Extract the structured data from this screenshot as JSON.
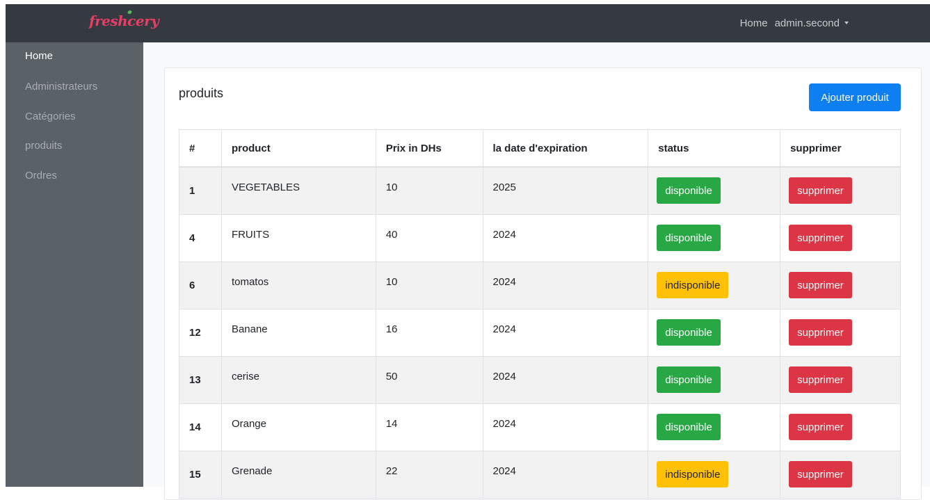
{
  "navbar": {
    "brand": "freshcery",
    "links": {
      "home": "Home",
      "user": "admin.second"
    }
  },
  "sidebar": {
    "items": [
      {
        "label": "Home",
        "active": true
      },
      {
        "label": "Administrateurs",
        "active": false
      },
      {
        "label": "Catégories",
        "active": false
      },
      {
        "label": "produits",
        "active": false
      },
      {
        "label": "Ordres",
        "active": false
      }
    ]
  },
  "main": {
    "title": "produits",
    "add_button": "Ajouter produit",
    "table": {
      "headers": [
        "#",
        "product",
        "Prix in DHs",
        "la date d'expiration",
        "status",
        "supprimer"
      ],
      "rows": [
        {
          "id": "1",
          "product": "VEGETABLES",
          "price": "10",
          "expiration": "2025",
          "status": "disponible",
          "delete": "supprimer"
        },
        {
          "id": "4",
          "product": "FRUITS",
          "price": "40",
          "expiration": "2024",
          "status": "disponible",
          "delete": "supprimer"
        },
        {
          "id": "6",
          "product": "tomatos",
          "price": "10",
          "expiration": "2024",
          "status": "indisponible",
          "delete": "supprimer"
        },
        {
          "id": "12",
          "product": "Banane",
          "price": "16",
          "expiration": "2024",
          "status": "disponible",
          "delete": "supprimer"
        },
        {
          "id": "13",
          "product": "cerise",
          "price": "50",
          "expiration": "2024",
          "status": "disponible",
          "delete": "supprimer"
        },
        {
          "id": "14",
          "product": "Orange",
          "price": "14",
          "expiration": "2024",
          "status": "disponible",
          "delete": "supprimer"
        },
        {
          "id": "15",
          "product": "Grenade",
          "price": "22",
          "expiration": "2024",
          "status": "indisponible",
          "delete": "supprimer"
        }
      ]
    }
  },
  "colors": {
    "navbar_bg": "#343a40",
    "sidebar_bg": "#5a6268",
    "brand": "#e83e66",
    "primary": "#0d7ff0",
    "success": "#28a745",
    "warning": "#ffc107",
    "danger": "#dc3545"
  }
}
